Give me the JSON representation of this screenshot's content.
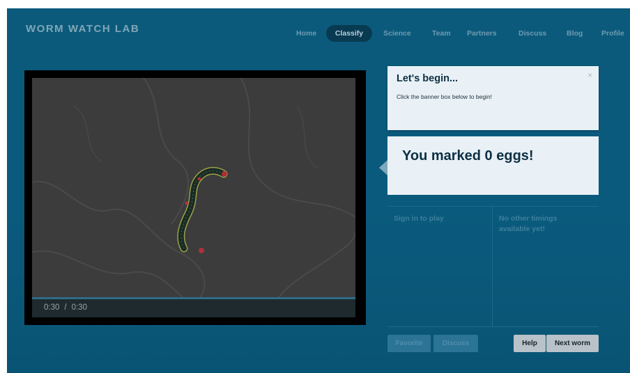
{
  "app": {
    "logo": "WORM WATCH LAB"
  },
  "nav": {
    "items": [
      {
        "label": "Home"
      },
      {
        "label": "Classify",
        "active": true
      },
      {
        "label": "Science"
      },
      {
        "label": "Team"
      },
      {
        "label": "Partners"
      },
      {
        "label": "Discuss"
      },
      {
        "label": "Blog"
      },
      {
        "label": "Profile"
      }
    ]
  },
  "video": {
    "current_time": "0:30",
    "separator": "/",
    "duration": "0:30",
    "progress": 1.0
  },
  "tip": {
    "title": "Let's begin...",
    "text": "Click the banner box below to begin!",
    "close": "×"
  },
  "eggs": {
    "message": "You marked 0 eggs!"
  },
  "panels": {
    "left": "Sign in to play",
    "right": "No other timings available yet!"
  },
  "buttons": {
    "favorite": "Favorite",
    "discuss": "Discuss",
    "help": "Help",
    "next": "Next worm"
  },
  "colors": {
    "background": "#0a5a7d",
    "nav_active": "#083a52",
    "panel_bg": "#e9f1f6",
    "heading": "#0e2f43"
  },
  "icons": {
    "close": "close-icon",
    "pointer": "arrow-left-pointer"
  }
}
